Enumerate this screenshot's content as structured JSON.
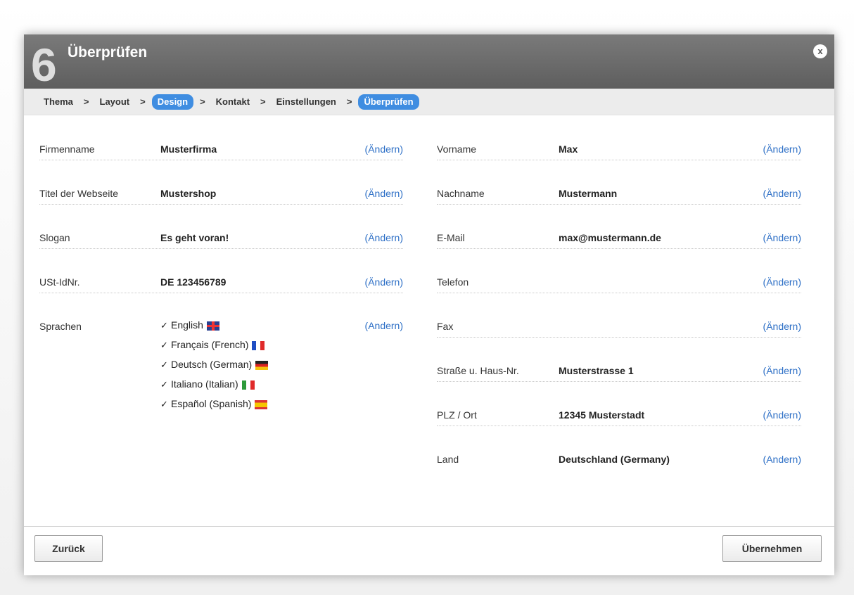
{
  "dialog": {
    "step_number": "6",
    "title": "Überprüfen",
    "close_label": "x"
  },
  "breadcrumb": {
    "items": [
      "Thema",
      "Layout",
      "Design",
      "Kontakt",
      "Einstellungen",
      "Überprüfen"
    ],
    "separator": ">",
    "active": [
      "Design",
      "Überprüfen"
    ]
  },
  "change_label": "(Ändern)",
  "change_label_alt": "(Andern)",
  "left": {
    "rows": [
      {
        "label": "Firmenname",
        "value": "Musterfirma"
      },
      {
        "label": "Titel der Webseite",
        "value": "Mustershop"
      },
      {
        "label": "Slogan",
        "value": "Es geht voran!"
      },
      {
        "label": "USt-IdNr.",
        "value": "DE 123456789"
      },
      {
        "label": "Sprachen",
        "value": ""
      }
    ],
    "languages": [
      {
        "name": "English",
        "flag": "flag-uk",
        "checked": true
      },
      {
        "name": "Français (French)",
        "flag": "flag-fr",
        "checked": true
      },
      {
        "name": "Deutsch (German)",
        "flag": "flag-de",
        "checked": true
      },
      {
        "name": "Italiano (Italian)",
        "flag": "flag-it",
        "checked": true
      },
      {
        "name": "Español (Spanish)",
        "flag": "flag-es",
        "checked": true
      }
    ]
  },
  "right": {
    "rows": [
      {
        "label": "Vorname",
        "value": "Max"
      },
      {
        "label": "Nachname",
        "value": "Mustermann"
      },
      {
        "label": "E-Mail",
        "value": "max@mustermann.de"
      },
      {
        "label": "Telefon",
        "value": ""
      },
      {
        "label": "Fax",
        "value": ""
      },
      {
        "label": "Straße u. Haus-Nr.",
        "value": "Musterstrasse 1"
      },
      {
        "label": "PLZ / Ort",
        "value": "12345 Musterstadt"
      },
      {
        "label": "Land",
        "value": "Deutschland (Germany)"
      }
    ]
  },
  "footer": {
    "back_label": "Zurück",
    "apply_label": "Übernehmen"
  },
  "colors": {
    "accent": "#3f8de1",
    "link": "#2d6fc6",
    "titlebar": "#6b6b6b"
  }
}
